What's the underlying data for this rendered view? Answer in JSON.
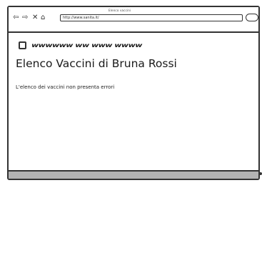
{
  "window": {
    "title": "Elenco vaccini"
  },
  "toolbar": {
    "back_icon": "back-arrow-icon",
    "forward_icon": "forward-arrow-icon",
    "close_icon": "close-icon",
    "home_icon": "home-icon",
    "url": "http://www.sanita.it/",
    "search_icon": "search-pill-icon"
  },
  "page": {
    "heading_scribble": "wwwwww ww www wwww",
    "title": "Elenco Vaccini di Bruna Rossi",
    "message": "L'elenco dei vaccini non presenta errori"
  },
  "colors": {
    "statusbar": "#b3b3b3",
    "line": "#333333"
  }
}
